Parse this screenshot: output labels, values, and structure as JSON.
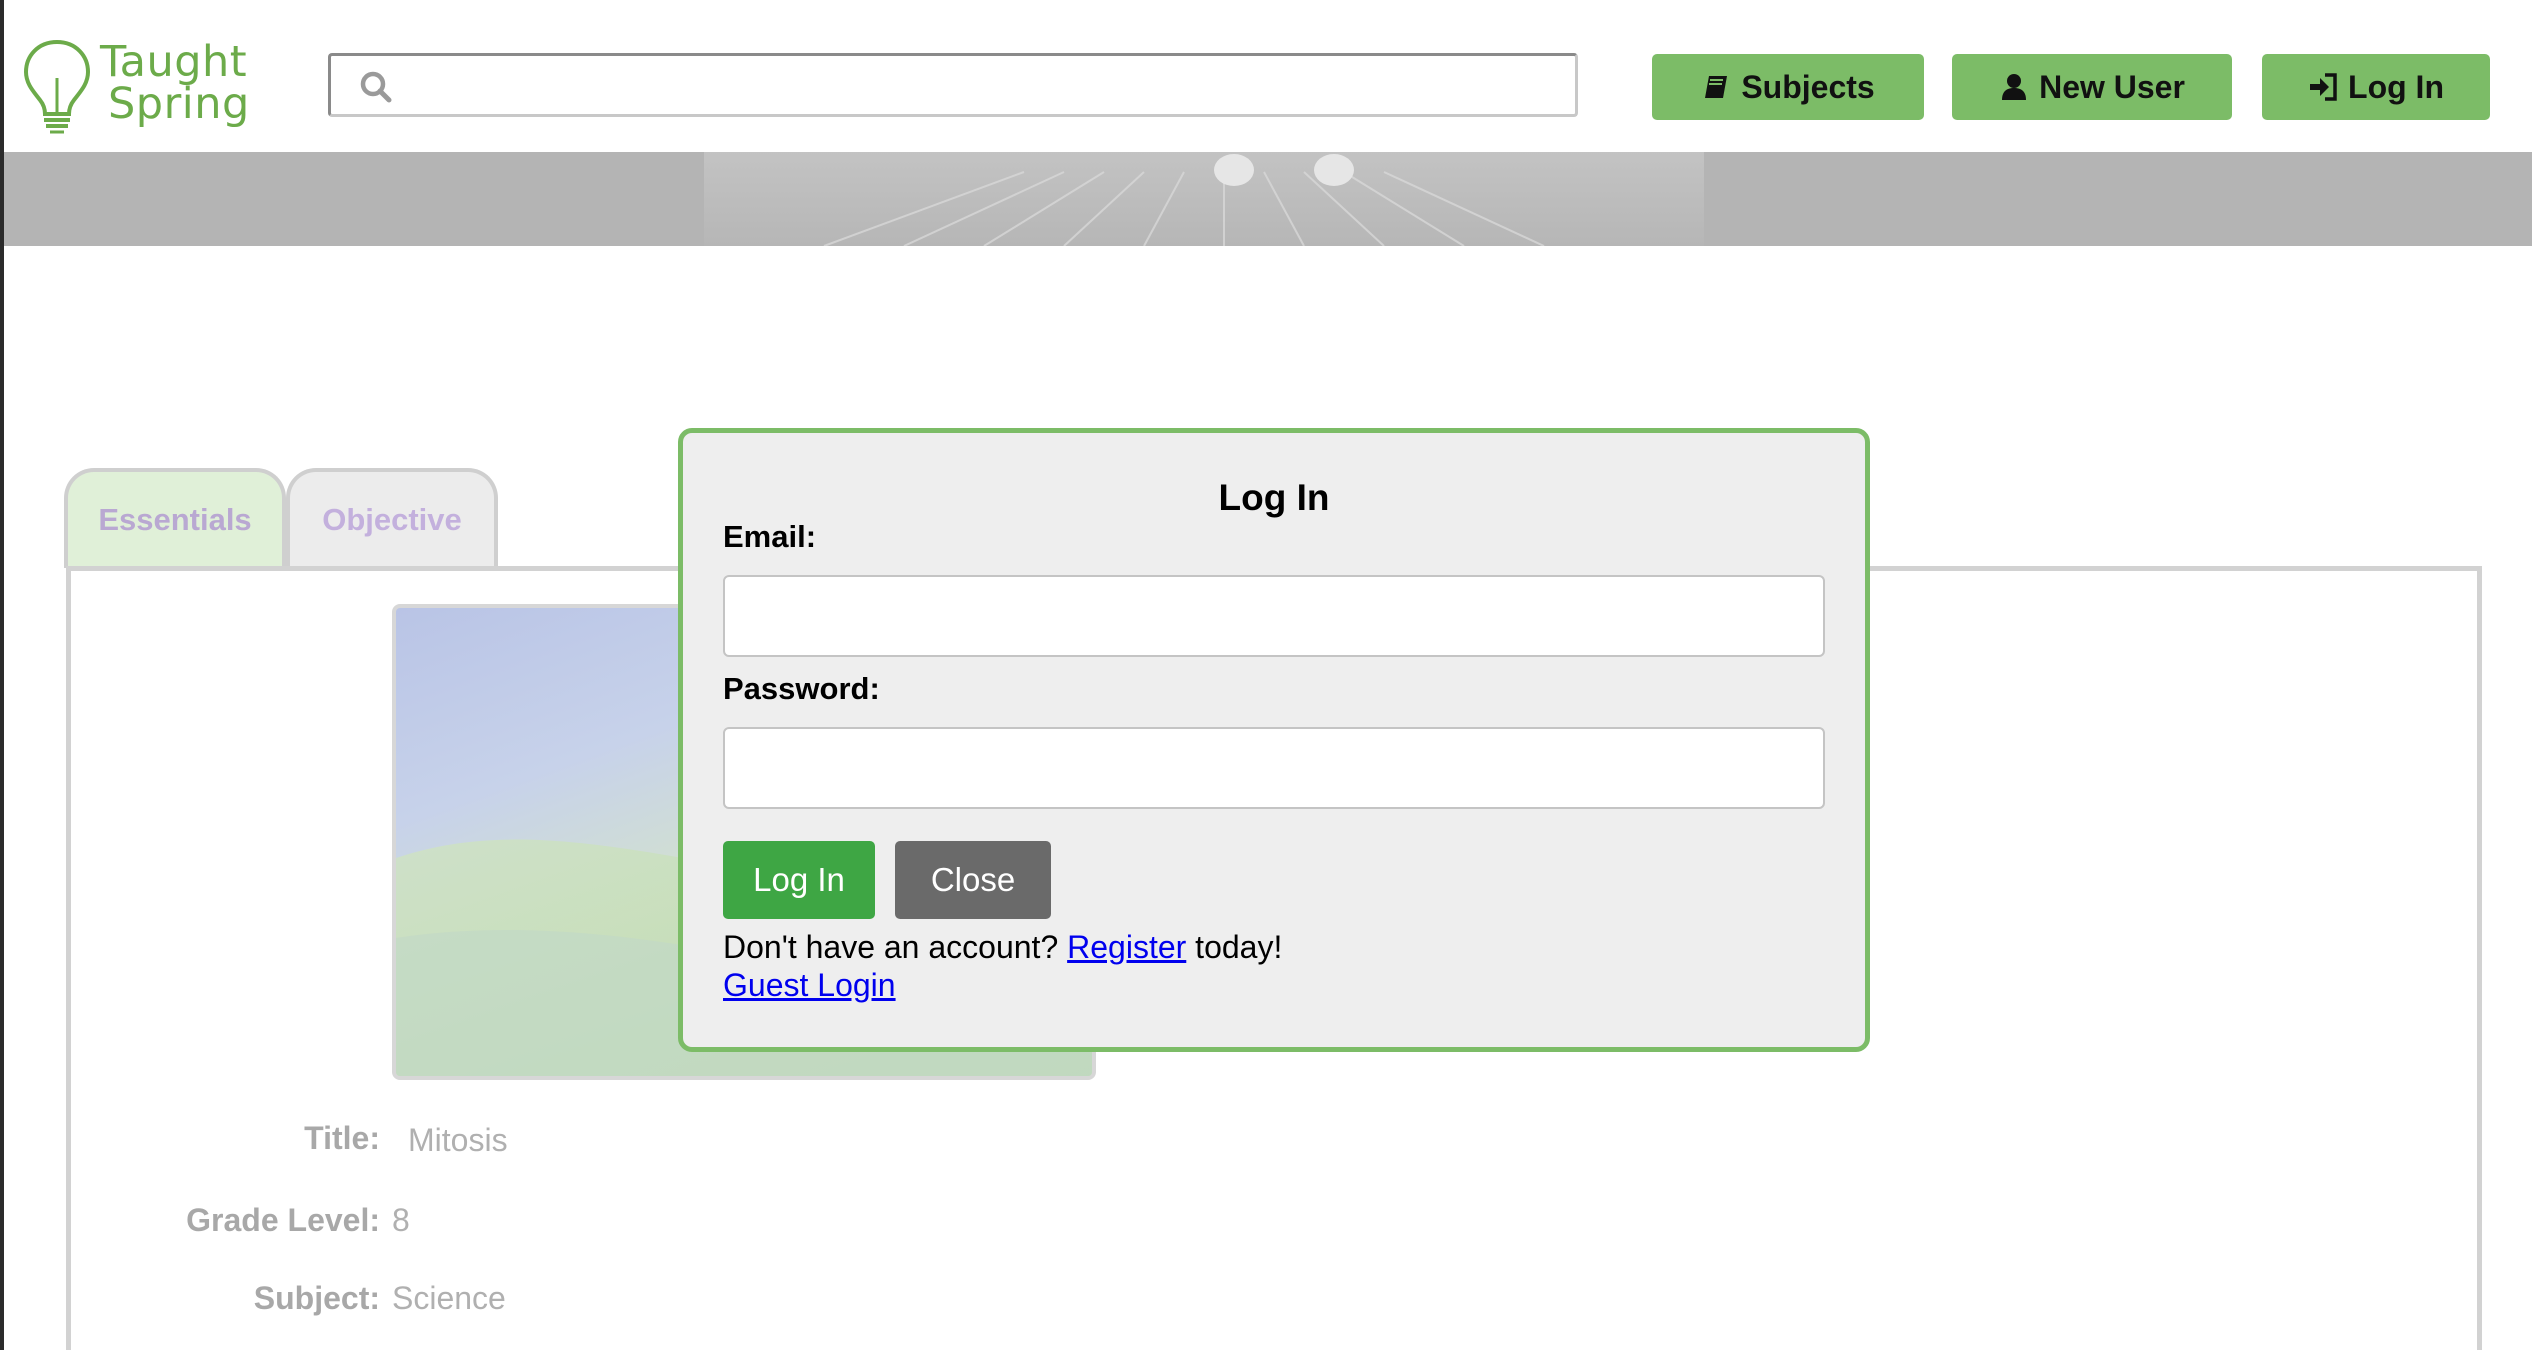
{
  "brand": {
    "line1": "Taught",
    "line2": "Spring",
    "color": "#6cab4a"
  },
  "header": {
    "search": {
      "icon": "search-icon",
      "value": "",
      "placeholder": ""
    },
    "nav": {
      "subjects": {
        "label": "Subjects",
        "icon": "book-icon"
      },
      "new_user": {
        "label": "New User",
        "icon": "user-icon"
      },
      "log_in": {
        "label": "Log In",
        "icon": "sign-in-icon"
      }
    },
    "accent": "#7cbc67"
  },
  "lesson": {
    "tabs": [
      {
        "label": "Essentials"
      },
      {
        "label": "Objective"
      }
    ],
    "fields": {
      "title": {
        "label": "Title:",
        "value": "Mitosis"
      },
      "grade_level": {
        "label": "Grade Level:",
        "value": "8"
      },
      "subject": {
        "label": "Subject:",
        "value": "Science"
      }
    }
  },
  "login_modal": {
    "title": "Log In",
    "email_label": "Email:",
    "email_value": "",
    "password_label": "Password:",
    "password_value": "",
    "login_button": "Log In",
    "close_button": "Close",
    "register_prefix": "Don't have an account?",
    "register_link": "Register",
    "register_suffix": "today!",
    "guest_link": "Guest Login",
    "border_color": "#7cbc67",
    "login_button_color": "#3ea644",
    "close_button_color": "#6a6a6a"
  }
}
